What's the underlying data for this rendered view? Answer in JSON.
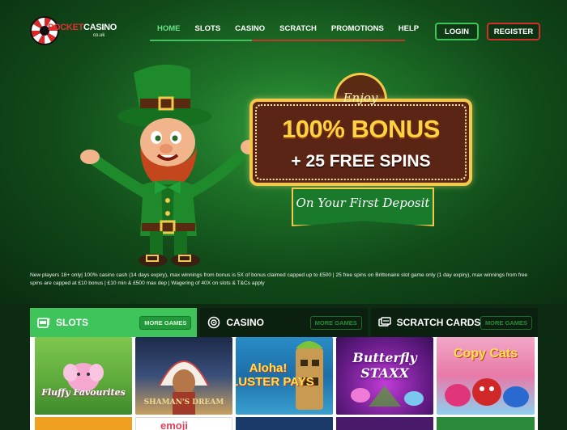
{
  "header": {
    "logo_pocket": "POCKET",
    "logo_casino": "CASINO",
    "logo_sub": "co.uk",
    "nav": [
      {
        "label": "HOME",
        "active": true
      },
      {
        "label": "SLOTS",
        "active": false
      },
      {
        "label": "CASINO",
        "active": false
      },
      {
        "label": "SCRATCH",
        "active": false
      },
      {
        "label": "PROMOTIONS",
        "active": false
      },
      {
        "label": "HELP",
        "active": false
      }
    ],
    "login_label": "LOGIN",
    "register_label": "REGISTER"
  },
  "hero": {
    "enjoy": "Enjoy",
    "bonus": "100% BONUS",
    "spins": "+ 25 FREE SPINS",
    "deposit": "On Your First Deposit",
    "disclaimer": "New players 18+ only| 100% casino cash (14 days expiry), max winnings from bonus is 5X of bonus claimed capped up to £500 | 25 free spins on Brittonaire slot game only (1 day expiry), max winnings from free spins are capped at £10 bonus | £10 min & £500 max dep | Wagering of 40X on slots & T&Cs apply"
  },
  "games": {
    "tabs": [
      {
        "label": "SLOTS",
        "icon": "slot-machine-icon",
        "more": "MORE GAMES",
        "active": true
      },
      {
        "label": "CASINO",
        "icon": "roulette-icon",
        "more": "MORE GAMES",
        "active": false
      },
      {
        "label": "SCRATCH CARDS",
        "icon": "scratch-card-icon",
        "more": "MORE GAMES",
        "active": false
      }
    ],
    "tiles": [
      {
        "title": "Fluffy Favourites"
      },
      {
        "title": "SHAMAN'S DREAM"
      },
      {
        "title": "Aloha! CLUSTER PAYS"
      },
      {
        "title": "Butterfly STAXX"
      },
      {
        "title": "Copy Cats"
      }
    ],
    "row2_partial": "emoji"
  },
  "colors": {
    "accent_green": "#3ec45a",
    "accent_red": "#d32f2f",
    "gold": "#f4c84a"
  }
}
